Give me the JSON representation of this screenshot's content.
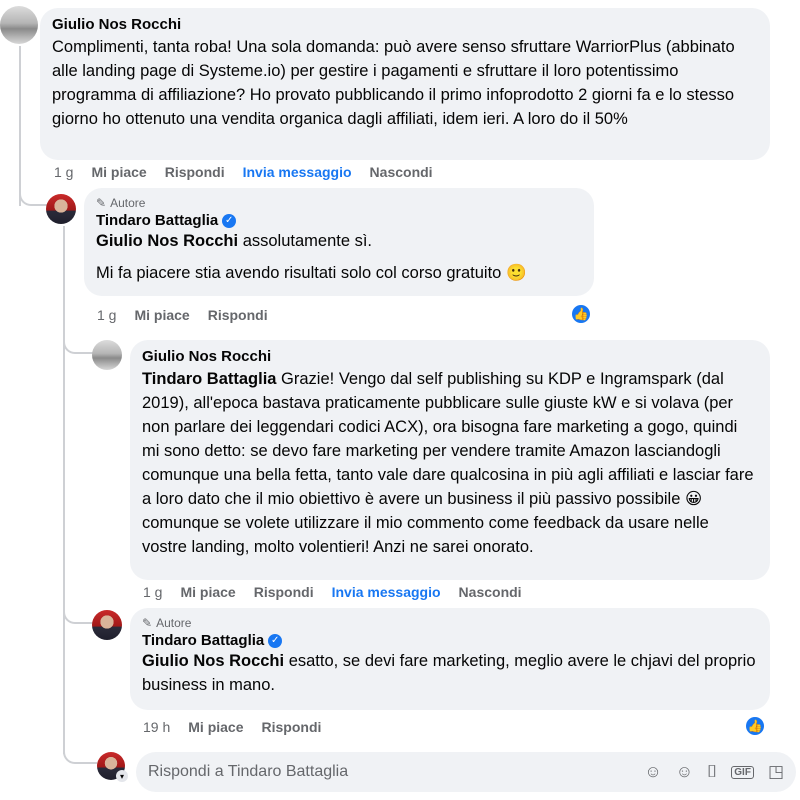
{
  "comments": [
    {
      "author": "Giulio Nos Rocchi",
      "text": "Complimenti, tanta roba! Una sola domanda: può avere senso sfruttare WarriorPlus (abbinato alle landing page di Systeme.io) per gestire i pagamenti e sfruttare il loro potentissimo programma di affiliazione? Ho provato pubblicando il primo infoprodotto 2 giorni fa e lo stesso giorno ho ottenuto una vendita organica dagli affiliati, idem ieri. A loro do il 50%",
      "time": "1 g",
      "actions": [
        "Mi piace",
        "Rispondi",
        "Invia messaggio",
        "Nascondi"
      ]
    },
    {
      "badge": "Autore",
      "author": "Tindaro Battaglia",
      "mention": "Giulio Nos Rocchi",
      "text": " assolutamente sì.",
      "text2": "Mi fa piacere stia avendo risultati solo col corso gratuito 🙂",
      "time": "1 g",
      "actions": [
        "Mi piace",
        "Rispondi"
      ]
    },
    {
      "author": "Giulio Nos Rocchi",
      "mention": "Tindaro Battaglia",
      "text": " Grazie! Vengo dal self publishing su KDP e Ingramspark (dal 2019), all'epoca bastava praticamente pubblicare sulle giuste kW e si volava (per non parlare dei leggendari codici ACX), ora bisogna fare marketing a gogo, quindi mi sono detto: se devo fare marketing per vendere tramite Amazon lasciandogli comunque una bella fetta, tanto vale dare qualcosina in più agli affiliati e lasciar fare a loro dato che il mio obiettivo è avere un business il più passivo possibile 😀 comunque se volete utilizzare il mio commento come feedback da usare nelle vostre landing, molto volentieri! Anzi ne sarei onorato.",
      "time": "1 g",
      "actions": [
        "Mi piace",
        "Rispondi",
        "Invia messaggio",
        "Nascondi"
      ]
    },
    {
      "badge": "Autore",
      "author": "Tindaro Battaglia",
      "mention": "Giulio Nos Rocchi",
      "text": " esatto, se devi fare marketing, meglio avere le chjavi del proprio business in mano.",
      "time": "19 h",
      "actions": [
        "Mi piace",
        "Rispondi"
      ]
    }
  ],
  "reply_box": {
    "placeholder": "Rispondi a Tindaro Battaglia",
    "tools": [
      "sticker-face-icon",
      "emoji-icon",
      "camera-icon",
      "gif-icon",
      "sticker-icon"
    ]
  },
  "colors": {
    "accent": "#1877f2",
    "bubble": "#f0f2f5",
    "muted": "#65676b"
  }
}
